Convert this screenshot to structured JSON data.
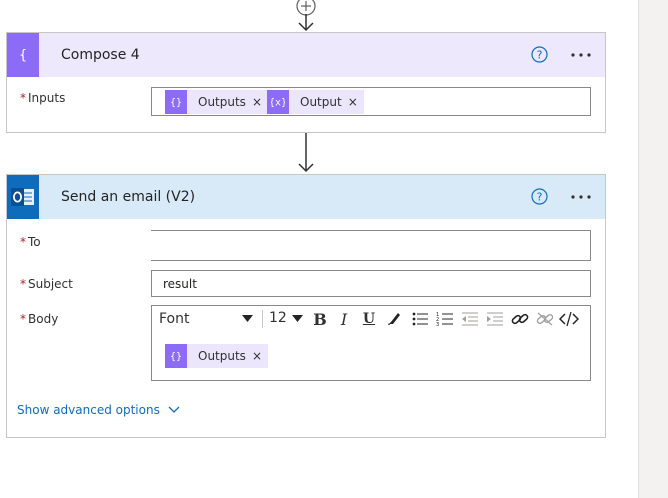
{
  "compose": {
    "title": "Compose 4",
    "inputs_label": "Inputs",
    "tokens": [
      {
        "text": "Outputs",
        "icon": "compose-expression-icon"
      },
      {
        "text": "Output",
        "icon": "variable-icon"
      }
    ]
  },
  "email": {
    "title": "Send an email (V2)",
    "to_label": "To",
    "to_value": "",
    "subject_label": "Subject",
    "subject_value": "result",
    "body_label": "Body",
    "toolbar": {
      "font": "Font",
      "size": "12",
      "bold": "B",
      "italic": "I",
      "underline": "U"
    },
    "body_token": "Outputs",
    "advanced_link": "Show advanced options"
  },
  "required_mark": "*",
  "remove_glyph": "×",
  "colors": {
    "compose_accent": "#8c6cf6",
    "compose_header": "#ede8fb",
    "email_accent": "#0f6cbd",
    "email_header": "#d8eaf8",
    "required": "#a4262c"
  }
}
